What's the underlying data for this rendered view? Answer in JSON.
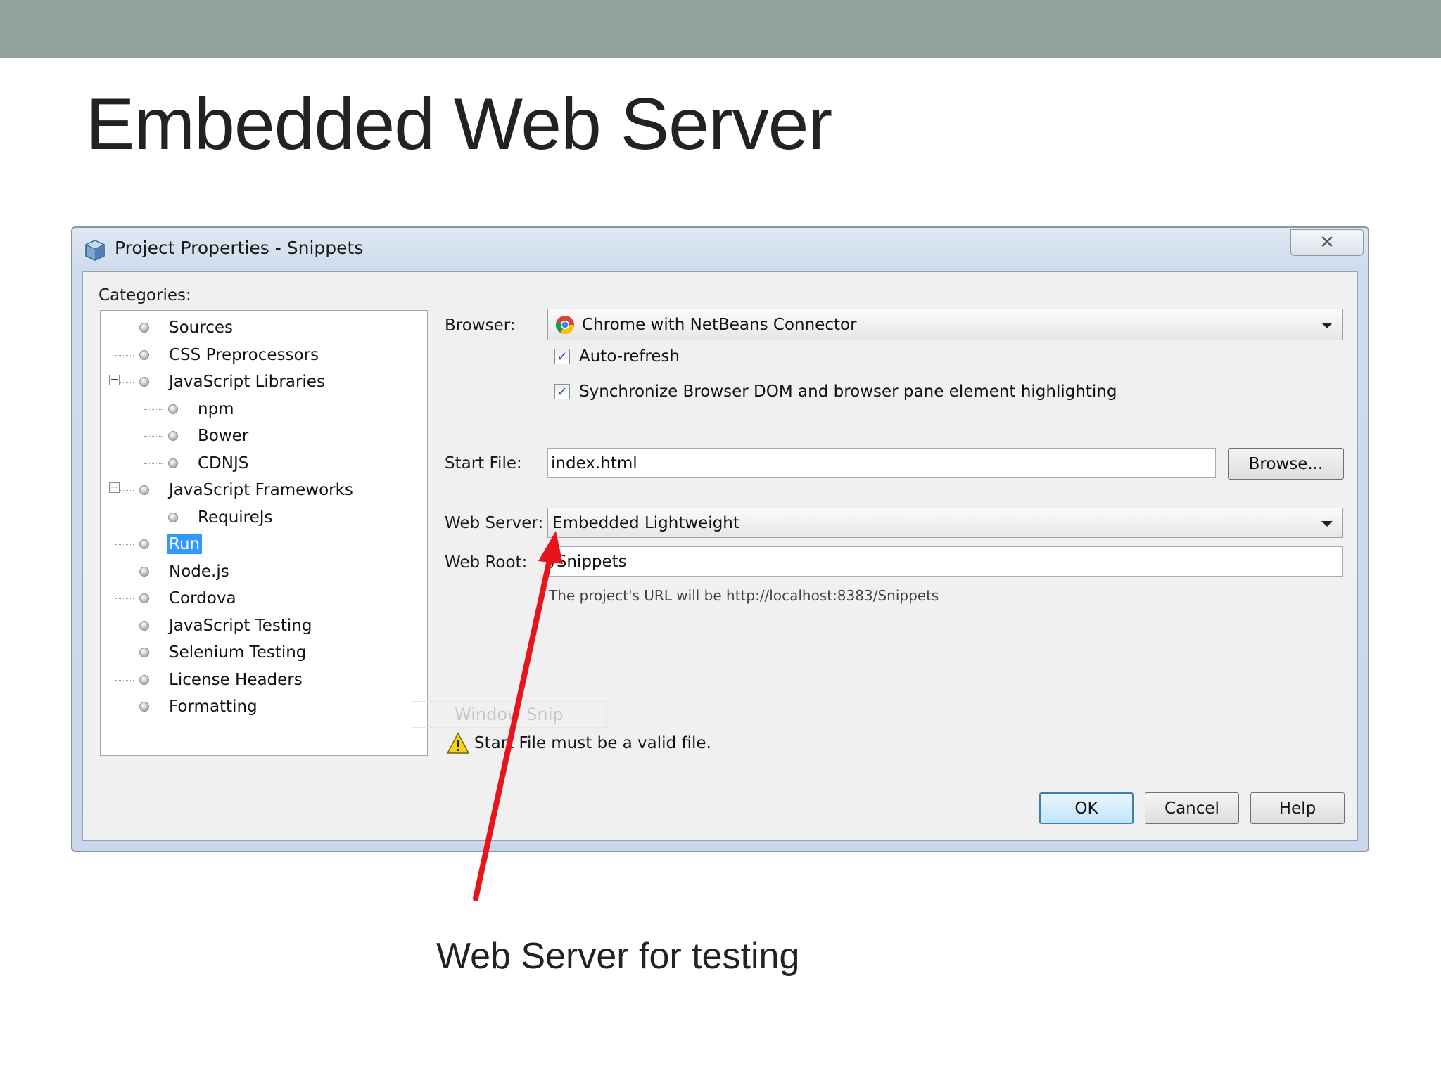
{
  "slide": {
    "title": "Embedded Web Server",
    "caption": "Web Server for testing",
    "accent_bar_color": "#91a39a",
    "annotation_arrow_color": "#e8141b"
  },
  "dialog": {
    "title": "Project Properties - Snippets",
    "icon": "netbeans-project-cube-icon",
    "close_glyph": "✕",
    "categories_label": "Categories:",
    "tree": [
      {
        "label": "Sources",
        "level": 0
      },
      {
        "label": "CSS Preprocessors",
        "level": 0
      },
      {
        "label": "JavaScript Libraries",
        "level": 0,
        "expanded": true
      },
      {
        "label": "npm",
        "level": 1
      },
      {
        "label": "Bower",
        "level": 1
      },
      {
        "label": "CDNJS",
        "level": 1
      },
      {
        "label": "JavaScript Frameworks",
        "level": 0,
        "expanded": true
      },
      {
        "label": "RequireJs",
        "level": 1
      },
      {
        "label": "Run",
        "level": 0,
        "selected": true
      },
      {
        "label": "Node.js",
        "level": 0
      },
      {
        "label": "Cordova",
        "level": 0
      },
      {
        "label": "JavaScript Testing",
        "level": 0
      },
      {
        "label": "Selenium Testing",
        "level": 0
      },
      {
        "label": "License Headers",
        "level": 0
      },
      {
        "label": "Formatting",
        "level": 0
      }
    ],
    "browser": {
      "label": "Browser:",
      "value": "Chrome with NetBeans Connector",
      "icon": "chrome-icon"
    },
    "auto_refresh": {
      "label": "Auto-refresh",
      "checked": true
    },
    "sync_dom": {
      "label": "Synchronize Browser DOM and browser pane element highlighting",
      "checked": true
    },
    "start_file": {
      "label": "Start File:",
      "value": "index.html",
      "browse": "Browse..."
    },
    "web_server": {
      "label": "Web Server:",
      "value": "Embedded Lightweight"
    },
    "web_root": {
      "label": "Web Root:",
      "value": "/Snippets"
    },
    "url_hint": "The project's URL will be http://localhost:8383/Snippets",
    "ghost_overlay": "Window Snip",
    "warning": {
      "text": "Start File must be a valid file.",
      "icon": "warning-triangle-icon"
    },
    "buttons": {
      "ok": "OK",
      "cancel": "Cancel",
      "help": "Help"
    }
  }
}
